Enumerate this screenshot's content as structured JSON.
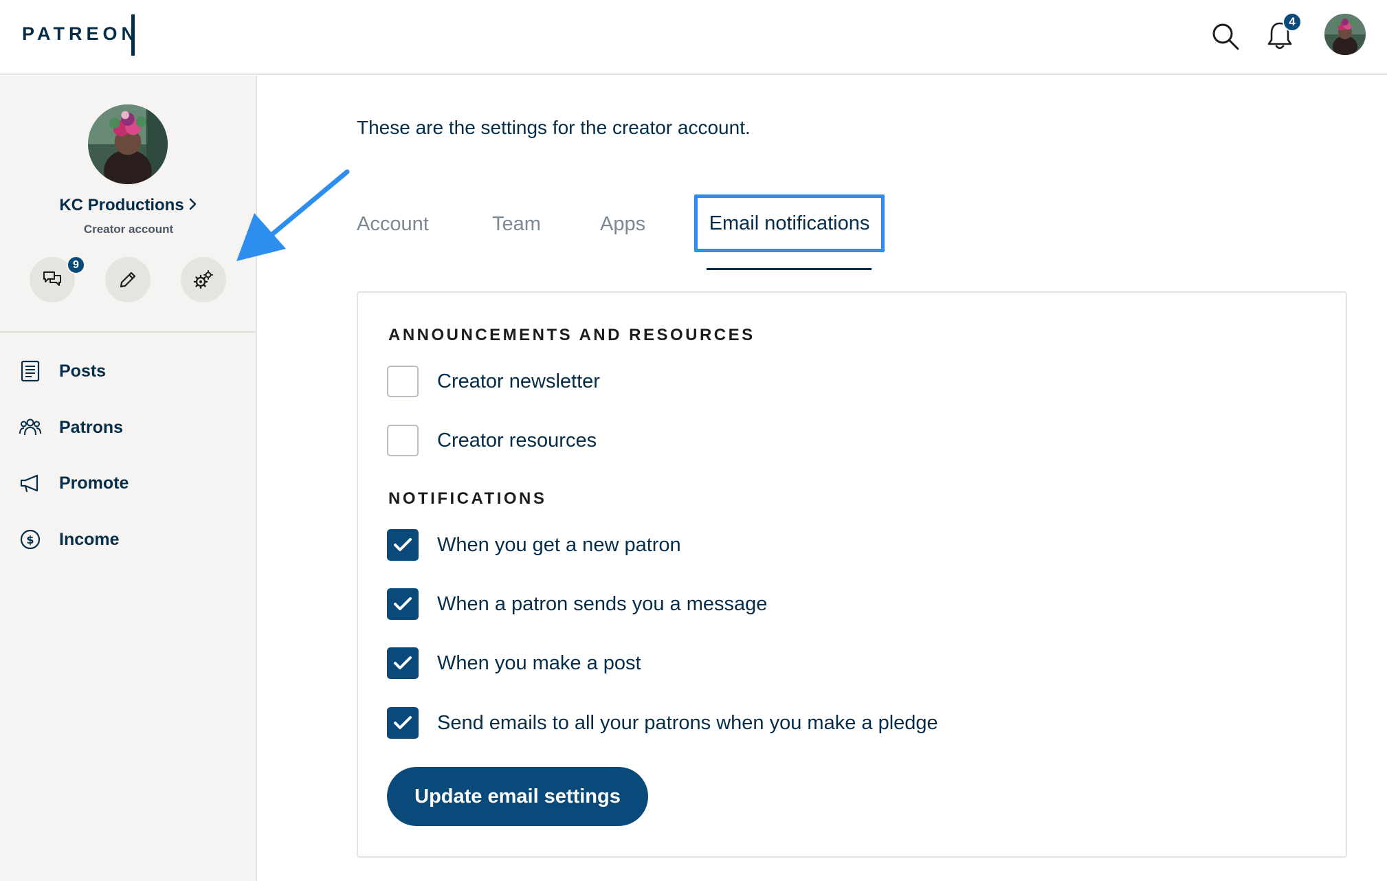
{
  "header": {
    "logo_text": "PATREON",
    "notification_count": "4"
  },
  "sidebar": {
    "creator_name": "KC Productions",
    "creator_subtitle": "Creator account",
    "messages_badge": "9",
    "nav": [
      {
        "label": "Posts",
        "icon": "posts-icon"
      },
      {
        "label": "Patrons",
        "icon": "patrons-icon"
      },
      {
        "label": "Promote",
        "icon": "megaphone-icon"
      },
      {
        "label": "Income",
        "icon": "dollar-icon"
      }
    ]
  },
  "main": {
    "intro": "These are the settings for the creator account.",
    "tabs": [
      {
        "label": "Account",
        "active": false
      },
      {
        "label": "Team",
        "active": false
      },
      {
        "label": "Apps",
        "active": false
      },
      {
        "label": "Email notifications",
        "active": true
      }
    ],
    "sections": [
      {
        "title": "ANNOUNCEMENTS AND RESOURCES",
        "items": [
          {
            "label": "Creator newsletter",
            "checked": false
          },
          {
            "label": "Creator resources",
            "checked": false
          }
        ]
      },
      {
        "title": "NOTIFICATIONS",
        "items": [
          {
            "label": "When you get a new patron",
            "checked": true
          },
          {
            "label": "When a patron sends you a message",
            "checked": true
          },
          {
            "label": "When you make a post",
            "checked": true
          },
          {
            "label": "Send emails to all your patrons when you make a pledge",
            "checked": true
          }
        ]
      }
    ],
    "submit_label": "Update email settings"
  },
  "colors": {
    "brand_navy": "#052d49",
    "checkbox_blue": "#0a4a7a",
    "highlight_blue": "#2d8ef0",
    "sidebar_bg": "#f5f4f2"
  }
}
